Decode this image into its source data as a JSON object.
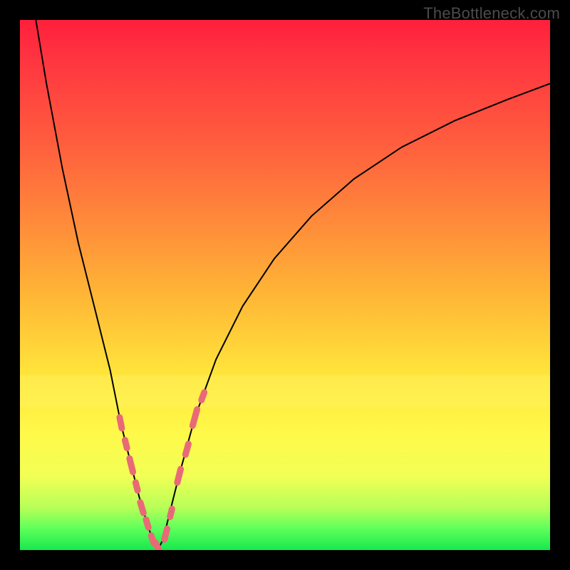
{
  "watermark": "TheBottleneck.com",
  "colors": {
    "frame": "#000000",
    "gradient_top": "#ff1f3b",
    "gradient_bottom": "#17e84e",
    "curve": "#000000",
    "marker": "#e96a77"
  },
  "chart_data": {
    "type": "line",
    "title": "",
    "xlabel": "",
    "ylabel": "",
    "xlim": [
      0,
      100
    ],
    "ylim": [
      0,
      100
    ],
    "series": [
      {
        "name": "bottleneck-curve",
        "x": [
          3,
          5,
          8,
          11,
          14,
          17,
          19,
          21,
          22.5,
          24,
          25,
          26,
          27,
          28,
          30,
          33,
          37,
          42,
          48,
          55,
          63,
          72,
          82,
          92,
          100
        ],
        "y": [
          100,
          88,
          72,
          58,
          46,
          34,
          24,
          16,
          10,
          5,
          2,
          0,
          2,
          6,
          14,
          25,
          36,
          46,
          55,
          63,
          70,
          76,
          81,
          85,
          88
        ]
      }
    ],
    "markers": [
      {
        "branch": "left",
        "x": 19.0,
        "y": 24.0,
        "len": 6
      },
      {
        "branch": "left",
        "x": 20.0,
        "y": 20.0,
        "len": 5
      },
      {
        "branch": "left",
        "x": 21.0,
        "y": 16.0,
        "len": 7
      },
      {
        "branch": "left",
        "x": 22.0,
        "y": 12.0,
        "len": 5
      },
      {
        "branch": "left",
        "x": 23.0,
        "y": 8.0,
        "len": 6
      },
      {
        "branch": "left",
        "x": 24.0,
        "y": 5.0,
        "len": 5
      },
      {
        "branch": "left",
        "x": 25.0,
        "y": 2.0,
        "len": 5
      },
      {
        "branch": "left",
        "x": 26.0,
        "y": 0.5,
        "len": 6
      },
      {
        "branch": "right",
        "x": 27.5,
        "y": 3.0,
        "len": 6
      },
      {
        "branch": "right",
        "x": 28.5,
        "y": 7.0,
        "len": 5
      },
      {
        "branch": "right",
        "x": 30.0,
        "y": 14.0,
        "len": 7
      },
      {
        "branch": "right",
        "x": 31.5,
        "y": 19.0,
        "len": 6
      },
      {
        "branch": "right",
        "x": 33.0,
        "y": 25.0,
        "len": 8
      },
      {
        "branch": "right",
        "x": 34.5,
        "y": 29.0,
        "len": 5
      }
    ],
    "yellow_band": {
      "y_from": 27,
      "y_to": 33
    }
  }
}
